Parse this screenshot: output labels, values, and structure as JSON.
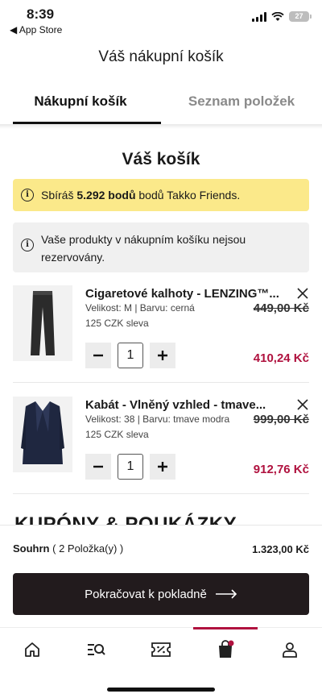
{
  "status_bar": {
    "time": "8:39",
    "back_app": "◀ App Store",
    "battery": "27"
  },
  "header": {
    "title": "Váš nákupní košík"
  },
  "tabs": [
    {
      "label": "Nákupní košík",
      "active": true
    },
    {
      "label": "Seznam položek",
      "active": false
    }
  ],
  "cart": {
    "title": "Váš košík",
    "points_notice": {
      "prefix": "Sbíráš",
      "points": "5.292 bodů",
      "suffix": "bodů Takko Friends."
    },
    "reserve_notice": "Vaše produkty v nákupním košíku nejsou rezervovány.",
    "items": [
      {
        "name": "Cigaretové kalhoty - LENZING™...",
        "meta": "Velikost: M | Barvu: cerná",
        "discount": "125 CZK sleva",
        "old_price": "449,00 Kč",
        "quantity": "1",
        "new_price": "410,24 Kč",
        "icon": "trousers-icon"
      },
      {
        "name": "Kabát - Vlněný vzhled - tmave...",
        "meta": "Velikost: 38 | Barvu: tmave modra",
        "discount": "125 CZK sleva",
        "old_price": "999,00 Kč",
        "quantity": "1",
        "new_price": "912,76 Kč",
        "icon": "coat-icon"
      }
    ],
    "coupons_heading": "KUPÓNY & POUKÁZKY"
  },
  "summary": {
    "label": "Souhrn",
    "count": "( 2 Položka(y) )",
    "total": "1.323,00 Kč",
    "checkout_label": "Pokračovat k pokladně"
  },
  "bottom_nav": [
    {
      "icon": "home-icon",
      "active": false
    },
    {
      "icon": "search-list-icon",
      "active": false
    },
    {
      "icon": "coupon-icon",
      "active": false
    },
    {
      "icon": "shopping-bag-icon",
      "active": true
    },
    {
      "icon": "account-icon",
      "active": false
    }
  ],
  "colors": {
    "accent": "#b0123f",
    "notice_yellow": "#fbe98a",
    "button_dark": "#221b1d"
  }
}
